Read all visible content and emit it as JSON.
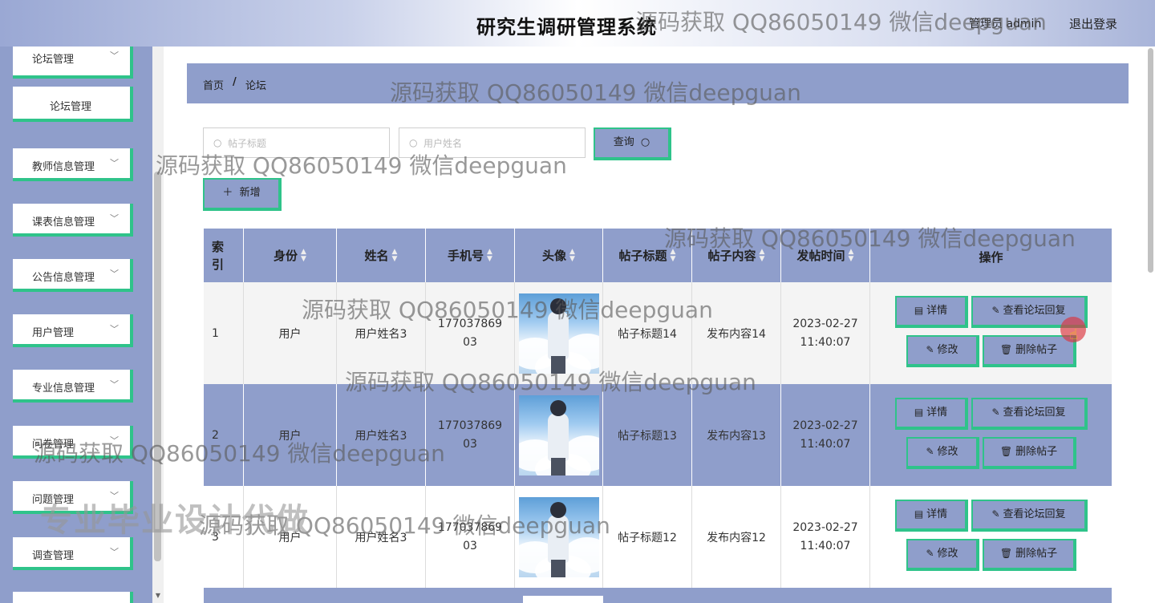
{
  "header": {
    "title": "研究生调研管理系统",
    "user": "管理员 admin",
    "logout": "退出登录"
  },
  "sidebar": {
    "items": [
      {
        "label": "论坛管理",
        "chevron": "﹀"
      },
      {
        "label": "论坛管理",
        "sub": true
      },
      {
        "label": "教师信息管理",
        "chevron": "﹀"
      },
      {
        "label": "课表信息管理",
        "chevron": "﹀"
      },
      {
        "label": "公告信息管理",
        "chevron": "﹀"
      },
      {
        "label": "用户管理",
        "chevron": "﹀"
      },
      {
        "label": "专业信息管理",
        "chevron": "﹀"
      },
      {
        "label": "问卷管理",
        "chevron": "﹀"
      },
      {
        "label": "问题管理",
        "chevron": "﹀"
      },
      {
        "label": "调查管理",
        "chevron": "﹀"
      }
    ]
  },
  "breadcrumb": {
    "home": "首页",
    "separator": "/",
    "current": "论坛"
  },
  "search": {
    "title_placeholder": "帖子标题",
    "name_placeholder": "用户姓名",
    "query_label": "查询",
    "add_label": "新增"
  },
  "table": {
    "headers": [
      "索引",
      "身份",
      "姓名",
      "手机号",
      "头像",
      "帖子标题",
      "帖子内容",
      "发帖时间",
      "操作"
    ],
    "rows": [
      {
        "index": "1",
        "role": "用户",
        "name": "用户姓名3",
        "phone1": "177037869",
        "phone2": "03",
        "title": "帖子标题14",
        "content": "发布内容14",
        "date": "2023-02-27",
        "time": "11:40:07"
      },
      {
        "index": "2",
        "role": "用户",
        "name": "用户姓名3",
        "phone1": "177037869",
        "phone2": "03",
        "title": "帖子标题13",
        "content": "发布内容13",
        "date": "2023-02-27",
        "time": "11:40:07"
      },
      {
        "index": "3",
        "role": "用户",
        "name": "用户姓名3",
        "phone1": "177037869",
        "phone2": "03",
        "title": "帖子标题12",
        "content": "发布内容12",
        "date": "2023-02-27",
        "time": "11:40:07"
      }
    ],
    "ops": {
      "detail": "详情",
      "view_reply": "查看论坛回复",
      "edit": "修改",
      "delete": "删除帖子"
    }
  },
  "watermarks": {
    "text": "源码获取 QQ86050149 微信deepguan",
    "big": "专业毕业设计代做"
  },
  "colors": {
    "accent_green": "#2fc38a",
    "panel_blue": "#8f9ecb"
  }
}
